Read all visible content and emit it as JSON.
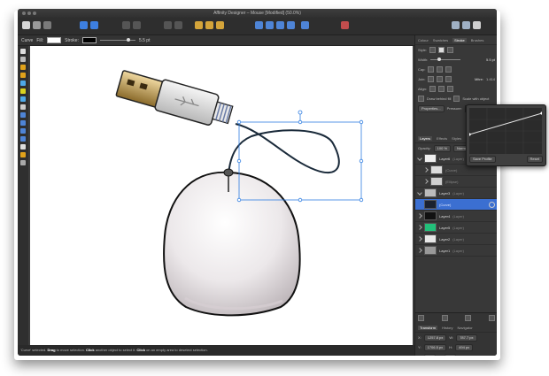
{
  "window": {
    "title": "Affinity Designer – Mouse [Modified] (50.0%)"
  },
  "context_bar": {
    "object_label": "Curve",
    "fill_label": "Fill:",
    "stroke_label": "Stroke:",
    "stroke_width": "5.5 pt"
  },
  "status_bar": {
    "text_before": "'Curve' selected. ",
    "drag": "Drag",
    "text_mid1": " to move selection. ",
    "click1": "Click",
    "text_mid2": " another object to select it. ",
    "click2": "Click",
    "text_end": " on an empty area to deselect selection."
  },
  "stroke_panel": {
    "tabs": [
      "Colour",
      "Swatches",
      "Stroke",
      "Brushes"
    ],
    "active_tab": "Stroke",
    "style_label": "Style:",
    "width_label": "Width:",
    "width_value": "5.5 pt",
    "cap_label": "Cap:",
    "join_label": "Join:",
    "mitre_label": "Mitre:",
    "mitre_value": "1.414",
    "align_label": "Align:",
    "draw_behind_label": "Draw behind fill",
    "scale_label": "Scale with object",
    "properties_button": "Properties...",
    "pressure_label": "Pressure:"
  },
  "layers_panel": {
    "tabs": [
      "Layers",
      "Effects",
      "Styles"
    ],
    "active_tab": "Layers",
    "opacity_label": "Opacity:",
    "opacity_value": "100 %",
    "blend_mode": "Normal",
    "rows": [
      {
        "name": "Layer6",
        "kind": "(Layer)"
      },
      {
        "name": "",
        "kind": "(Curve)"
      },
      {
        "name": "",
        "kind": "(Ellipse)"
      },
      {
        "name": "Layer3",
        "kind": "(Layer)"
      },
      {
        "name": "",
        "kind": "(Curve)"
      },
      {
        "name": "Layer4",
        "kind": "(Layer)"
      },
      {
        "name": "Layer5",
        "kind": "(Layer)"
      },
      {
        "name": "Layer2",
        "kind": "(Layer)"
      },
      {
        "name": "Layer1",
        "kind": "(Layer)"
      }
    ]
  },
  "transform_panel": {
    "tabs": [
      "Transform",
      "History",
      "Navigator"
    ],
    "active_tab": "Transform",
    "x_label": "X:",
    "x_value": "1257.8 px",
    "y_label": "Y:",
    "y_value": "1706.5 px",
    "w_label": "W:",
    "w_value": "787.7 px",
    "h_label": "H:",
    "h_value": "494 px",
    "r_label": "R:",
    "r_value": "0 °",
    "s_label": "S:",
    "s_value": "0 °"
  },
  "pressure_popup": {
    "save_label": "Save Profile",
    "reset_label": "Reset"
  },
  "colors": {
    "selection": "#3b6fd1",
    "accent": "#2f7de1",
    "ui_dark": "#2e2e2e"
  }
}
